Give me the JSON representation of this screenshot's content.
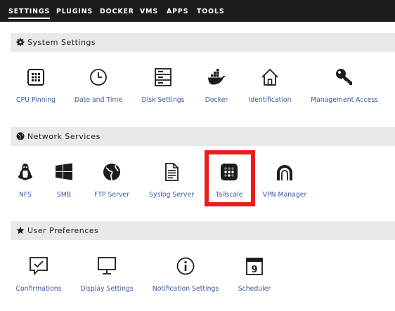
{
  "nav": {
    "items": [
      "SETTINGS",
      "PLUGINS",
      "DOCKER",
      "VMS",
      "APPS",
      "TOOLS"
    ],
    "active": "SETTINGS"
  },
  "sections": {
    "system": {
      "title": "System Settings",
      "icon": "gear-icon",
      "items": [
        {
          "label": "CPU Pinning",
          "icon": "cpu-icon"
        },
        {
          "label": "Date and Time",
          "icon": "clock-icon"
        },
        {
          "label": "Disk Settings",
          "icon": "disk-icon"
        },
        {
          "label": "Docker",
          "icon": "docker-icon"
        },
        {
          "label": "Identification",
          "icon": "home-icon"
        },
        {
          "label": "Management Access",
          "icon": "key-icon"
        }
      ]
    },
    "network": {
      "title": "Network Services",
      "icon": "globe-icon",
      "items": [
        {
          "label": "NFS",
          "icon": "linux-icon"
        },
        {
          "label": "SMB",
          "icon": "windows-icon"
        },
        {
          "label": "FTP Server",
          "icon": "globe-icon"
        },
        {
          "label": "Syslog Server",
          "icon": "document-icon"
        },
        {
          "label": "Tailscale",
          "icon": "tailscale-icon",
          "highlighted": true
        },
        {
          "label": "VPN Manager",
          "icon": "vpn-arch-icon"
        }
      ]
    },
    "user": {
      "title": "User Preferences",
      "icon": "star-icon",
      "items": [
        {
          "label": "Confirmations",
          "icon": "confirm-icon"
        },
        {
          "label": "Display Settings",
          "icon": "monitor-icon"
        },
        {
          "label": "Notification Settings",
          "icon": "info-icon"
        },
        {
          "label": "Scheduler",
          "icon": "calendar-icon"
        }
      ]
    }
  },
  "colors": {
    "navbar": "#1c1c1c",
    "link": "#3b5998",
    "section_bg": "#e9e9e9",
    "highlight": "#ec1c1c"
  }
}
